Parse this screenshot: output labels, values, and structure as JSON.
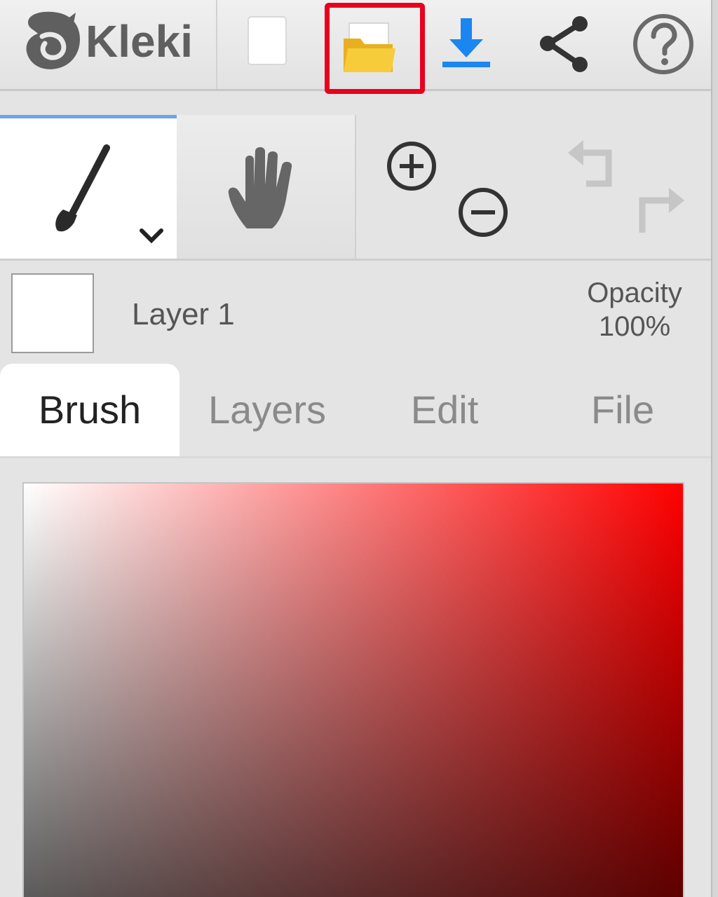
{
  "app": {
    "name": "Kleki"
  },
  "topbar": {
    "items": [
      "new-image",
      "open-image",
      "save-image",
      "share",
      "help"
    ],
    "highlighted": "open-image",
    "highlight_color": "#e8001e",
    "download_color": "#1b86ef",
    "folder_color": "#f1c12e"
  },
  "tools": {
    "active": "brush",
    "items": [
      "brush",
      "hand",
      "zoom-in",
      "zoom-out",
      "undo",
      "redo"
    ]
  },
  "layer": {
    "name": "Layer 1",
    "opacity_label": "Opacity",
    "opacity_value": "100%"
  },
  "tabs": {
    "items": [
      {
        "label": "Brush",
        "active": true
      },
      {
        "label": "Layers",
        "active": false
      },
      {
        "label": "Edit",
        "active": false
      },
      {
        "label": "File",
        "active": false
      }
    ]
  },
  "color_picker": {
    "hue_color": "#ff0000"
  }
}
